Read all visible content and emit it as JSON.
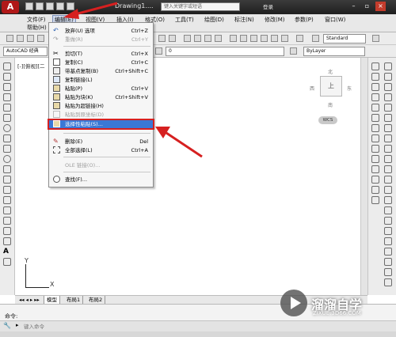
{
  "titlebar": {
    "app_logo": "A",
    "doc_title": "Drawing1....",
    "search_placeholder": "键入关键字或短语",
    "login": "登录",
    "minimize": "–",
    "restore": "▫",
    "close": "×"
  },
  "menubar": {
    "items": [
      "文件(F)",
      "编辑(E)",
      "视图(V)",
      "插入(I)",
      "格式(O)",
      "工具(T)",
      "绘图(D)",
      "标注(N)",
      "修改(M)",
      "参数(P)",
      "窗口(W)"
    ],
    "help": "帮助(H)"
  },
  "toolbar": {
    "workspace": "AutoCAD 经典",
    "text_style": "Standard",
    "layer": "0",
    "color": "ByLayer"
  },
  "viewport": {
    "label": "[-][俯视][二",
    "cube_face": "上",
    "north": "北",
    "south": "南",
    "east": "东",
    "west": "西",
    "wcs": "WCS",
    "ucs_x": "X",
    "ucs_y": "Y"
  },
  "tabs": [
    "模型",
    "布局1",
    "布局2"
  ],
  "command": {
    "label": "命令:",
    "placeholder": "键入命令"
  },
  "edit_menu": {
    "items": [
      {
        "label": "放弃(U) 选项",
        "shortcut": "Ctrl+Z",
        "icon": "undo-icon",
        "disabled": false
      },
      {
        "label": "重做(R)",
        "shortcut": "Ctrl+Y",
        "icon": "redo-icon",
        "disabled": true
      },
      {
        "label": "剪切(T)",
        "shortcut": "Ctrl+X",
        "icon": "cut-icon",
        "disabled": false
      },
      {
        "label": "复制(C)",
        "shortcut": "Ctrl+C",
        "icon": "copy-icon",
        "disabled": false
      },
      {
        "label": "带基点复制(B)",
        "shortcut": "Ctrl+Shift+C",
        "icon": "copy-base-icon",
        "disabled": false
      },
      {
        "label": "复制链接(L)",
        "shortcut": "",
        "icon": "copy-link-icon",
        "disabled": false
      },
      {
        "label": "粘贴(P)",
        "shortcut": "Ctrl+V",
        "icon": "paste-icon",
        "disabled": false
      },
      {
        "label": "粘贴为块(K)",
        "shortcut": "Ctrl+Shift+V",
        "icon": "paste-block-icon",
        "disabled": false
      },
      {
        "label": "粘贴为超链接(H)",
        "shortcut": "",
        "icon": "paste-hyperlink-icon",
        "disabled": false
      },
      {
        "label": "粘贴到原坐标(D)",
        "shortcut": "",
        "icon": "paste-orig-icon",
        "disabled": true
      },
      {
        "label": "选择性粘贴(S)...",
        "shortcut": "",
        "icon": "paste-special-icon",
        "disabled": false
      },
      {
        "label": "删除(E)",
        "shortcut": "Del",
        "icon": "erase-icon",
        "disabled": false
      },
      {
        "label": "全部选择(L)",
        "shortcut": "Ctrl+A",
        "icon": "select-all-icon",
        "disabled": false
      },
      {
        "label": "OLE 链接(O)...",
        "shortcut": "",
        "icon": "",
        "disabled": true
      },
      {
        "label": "查找(F)...",
        "shortcut": "",
        "icon": "find-icon",
        "disabled": false
      }
    ]
  },
  "watermark": {
    "name": "溜溜自学",
    "site": "ZIXUE.3D66.COM"
  },
  "colors": {
    "highlight": "#3a78d6",
    "annotation_red": "#d62020",
    "titlebar": "#2b2b2b"
  }
}
